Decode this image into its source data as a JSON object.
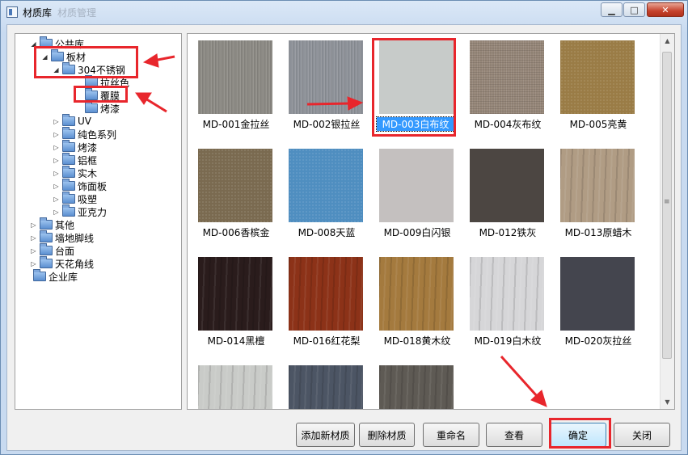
{
  "window": {
    "title": "材质库",
    "title_ghost": "材质管理",
    "minimize_glyph": "▁",
    "maximize_glyph": "□",
    "close_glyph": "✕"
  },
  "tree": {
    "expanded_glyph": "◢",
    "collapsed_glyph": "▷",
    "nodes": [
      {
        "label": "公共库",
        "expander": "expanded"
      },
      {
        "label": "板材",
        "expander": "expanded"
      },
      {
        "label": "304不锈钢",
        "expander": "expanded"
      },
      {
        "label": "拉丝色",
        "expander": "none"
      },
      {
        "label": "覆膜",
        "expander": "none"
      },
      {
        "label": "烤漆",
        "expander": "none"
      },
      {
        "label": "UV",
        "expander": "collapsed"
      },
      {
        "label": "纯色系列",
        "expander": "collapsed"
      },
      {
        "label": "烤漆",
        "expander": "collapsed"
      },
      {
        "label": "铝框",
        "expander": "collapsed"
      },
      {
        "label": "实木",
        "expander": "collapsed"
      },
      {
        "label": "饰面板",
        "expander": "collapsed"
      },
      {
        "label": "吸塑",
        "expander": "collapsed"
      },
      {
        "label": "亚克力",
        "expander": "collapsed"
      },
      {
        "label": "其他",
        "expander": "collapsed"
      },
      {
        "label": "墙地脚线",
        "expander": "collapsed"
      },
      {
        "label": "台面",
        "expander": "collapsed"
      },
      {
        "label": "天花角线",
        "expander": "collapsed"
      },
      {
        "label": "企业库",
        "expander": "none"
      }
    ]
  },
  "gallery": {
    "selected_index": 2,
    "scroll_up_glyph": "▲",
    "scroll_down_glyph": "▼",
    "scroll_grip_glyph": "≡",
    "materials": [
      {
        "label": "MD-001金拉丝",
        "color": "#8c8a84",
        "texture": "brushed"
      },
      {
        "label": "MD-002银拉丝",
        "color": "#8e9299",
        "texture": "brushed"
      },
      {
        "label": "MD-003白布纹",
        "color": "#c7cbc9",
        "texture": "plain"
      },
      {
        "label": "MD-004灰布纹",
        "color": "#958678",
        "texture": "woven"
      },
      {
        "label": "MD-005亮黄",
        "color": "#9a7c46",
        "texture": "grain"
      },
      {
        "label": "MD-006香槟金",
        "color": "#7a6a50",
        "texture": "grain"
      },
      {
        "label": "MD-008天蓝",
        "color": "#4f8ec0",
        "texture": "grain"
      },
      {
        "label": "MD-009白闪银",
        "color": "#c4c0bf",
        "texture": "plain"
      },
      {
        "label": "MD-012铁灰",
        "color": "#4c4642",
        "texture": "plain"
      },
      {
        "label": "MD-013原蜡木",
        "color": "#b09c84",
        "texture": "wood"
      },
      {
        "label": "MD-014黑檀",
        "color": "#2a1c1c",
        "texture": "wood"
      },
      {
        "label": "MD-016红花梨",
        "color": "#8c3218",
        "texture": "wood"
      },
      {
        "label": "MD-018黄木纹",
        "color": "#a47a3e",
        "texture": "wood"
      },
      {
        "label": "MD-019白木纹",
        "color": "#d6d6d8",
        "texture": "wood"
      },
      {
        "label": "MD-020灰拉丝",
        "color": "#44454e",
        "texture": "plain"
      },
      {
        "label": "",
        "color": "#c9cbc8",
        "texture": "wood"
      },
      {
        "label": "",
        "color": "#4c5564",
        "texture": "wood"
      },
      {
        "label": "",
        "color": "#5e5a54",
        "texture": "wood"
      }
    ]
  },
  "buttons": {
    "add": "添加新材质",
    "delete": "删除材质",
    "rename": "重命名",
    "view": "查看",
    "ok": "确定",
    "close": "关闭"
  },
  "annotation_color": "#e8262c"
}
